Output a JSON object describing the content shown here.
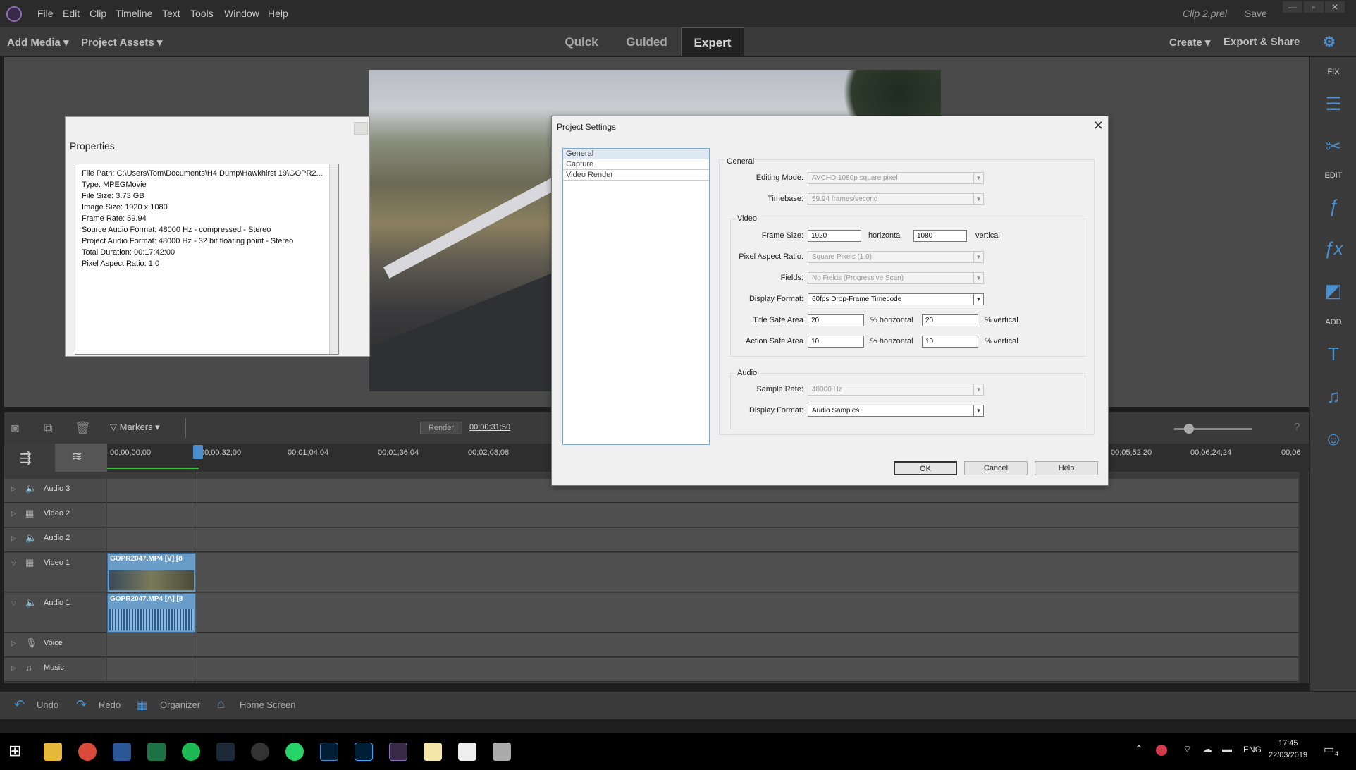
{
  "app": {
    "menu": [
      "File",
      "Edit",
      "Clip",
      "Timeline",
      "Text",
      "Tools",
      "Window",
      "Help"
    ],
    "document_name": "Clip 2.prel",
    "save_label": "Save"
  },
  "toolbar": {
    "add_media": "Add Media",
    "project_assets": "Project Assets",
    "modes": [
      "Quick",
      "Guided",
      "Expert"
    ],
    "active_mode": "Expert",
    "create": "Create",
    "export_share": "Export & Share"
  },
  "right_panel": {
    "fix_label": "FIX",
    "edit_label": "EDIT",
    "add_label": "ADD"
  },
  "properties": {
    "title": "Properties",
    "lines": [
      "File Path: C:\\Users\\Tom\\Documents\\H4 Dump\\Hawkhirst 19\\GOPR2...",
      "Type: MPEGMovie",
      "File Size: 3.73 GB",
      "Image Size: 1920 x 1080",
      "Frame Rate: 59.94",
      "Source Audio Format: 48000 Hz - compressed - Stereo",
      "Project Audio Format: 48000 Hz - 32 bit floating point - Stereo",
      "Total Duration: 00:17:42:00",
      "Pixel Aspect Ratio: 1.0"
    ]
  },
  "timeline": {
    "markers_label": "Markers",
    "render_label": "Render",
    "current_time": "00;00;31;50",
    "ruler": [
      "00;00;00;00",
      "00;00;32;00",
      "00;01;04;04",
      "00;01;36;04",
      "00;02;08;08",
      "00;05;52;20",
      "00;06;24;24",
      "00;06"
    ],
    "tracks": [
      {
        "name": "Audio 3"
      },
      {
        "name": "Video 2"
      },
      {
        "name": "Audio 2"
      },
      {
        "name": "Video 1"
      },
      {
        "name": "Audio 1"
      },
      {
        "name": "Voice"
      },
      {
        "name": "Music"
      }
    ],
    "clip_video_label": "GOPR2047.MP4 [V] [8",
    "clip_audio_label": "GOPR2047.MP4 [A] [8"
  },
  "bottom_bar": {
    "undo": "Undo",
    "redo": "Redo",
    "organizer": "Organizer",
    "home_screen": "Home Screen"
  },
  "dialog": {
    "title": "Project Settings",
    "nav": [
      "General",
      "Capture",
      "Video Render"
    ],
    "general_heading": "General",
    "editing_mode_label": "Editing Mode:",
    "editing_mode_value": "AVCHD 1080p square pixel",
    "timebase_label": "Timebase:",
    "timebase_value": "59.94 frames/second",
    "video_heading": "Video",
    "frame_size_label": "Frame Size:",
    "frame_w": "1920",
    "horizontal": "horizontal",
    "frame_h": "1080",
    "vertical": "vertical",
    "par_label": "Pixel Aspect Ratio:",
    "par_value": "Square Pixels (1.0)",
    "fields_label": "Fields:",
    "fields_value": "No Fields (Progressive Scan)",
    "display_format_label": "Display Format:",
    "display_format_value": "60fps Drop-Frame Timecode",
    "title_safe_label": "Title Safe Area",
    "title_safe_h": "20",
    "title_safe_v": "20",
    "pct_horizontal": "% horizontal",
    "pct_vertical": "% vertical",
    "action_safe_label": "Action Safe Area",
    "action_safe_h": "10",
    "action_safe_v": "10",
    "audio_heading": "Audio",
    "sample_rate_label": "Sample Rate:",
    "sample_rate_value": "48000 Hz",
    "audio_display_label": "Display Format:",
    "audio_display_value": "Audio Samples",
    "ok": "OK",
    "cancel": "Cancel",
    "help": "Help"
  },
  "taskbar": {
    "language": "ENG",
    "time": "17:45",
    "date": "22/03/2019",
    "notifications": "4"
  }
}
